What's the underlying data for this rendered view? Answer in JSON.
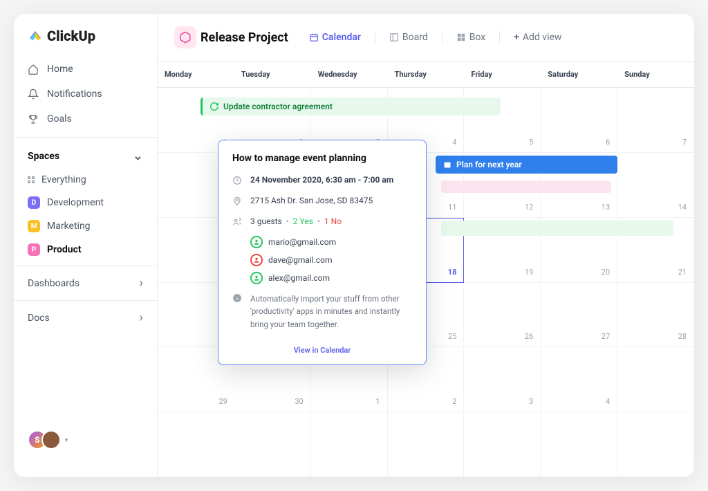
{
  "logo": "ClickUp",
  "nav": {
    "home": "Home",
    "notifications": "Notifications",
    "goals": "Goals"
  },
  "spaces": {
    "title": "Spaces",
    "everything": "Everything",
    "items": [
      {
        "letter": "D",
        "label": "Development",
        "color": "#7c6ff5"
      },
      {
        "letter": "M",
        "label": "Marketing",
        "color": "#fbbf24"
      },
      {
        "letter": "P",
        "label": "Product",
        "color": "#f472b6"
      }
    ]
  },
  "collapse": {
    "dashboards": "Dashboards",
    "docs": "Docs"
  },
  "project": {
    "title": "Release Project"
  },
  "views": {
    "calendar": "Calendar",
    "board": "Board",
    "box": "Box",
    "add": "Add view"
  },
  "weekdays": [
    "Monday",
    "Tuesday",
    "Wednesday",
    "Thursday",
    "Friday",
    "Saturday",
    "Sunday"
  ],
  "daynums": [
    "1",
    "2",
    "3",
    "4",
    "5",
    "6",
    "7",
    "",
    "",
    "",
    "11",
    "12",
    "13",
    "14",
    "",
    "",
    "",
    "18",
    "19",
    "20",
    "21",
    "",
    "",
    "",
    "25",
    "26",
    "27",
    "28",
    "29",
    "30",
    "1",
    "2",
    "3",
    "4"
  ],
  "events": {
    "contractor": "Update contractor agreement",
    "manage": "How to manage event planning",
    "plan": "Plan for next year"
  },
  "popover": {
    "title": "How to manage event planning",
    "datetime": "24 November 2020, 6:30 am - 7:00 am",
    "location": "2715 Ash Dr. San Jose, SD 83475",
    "guests_count": "3 guests",
    "yes": "2 Yes",
    "no": "1 No",
    "guests": [
      {
        "email": "mario@gmail.com",
        "color": "#22c55e"
      },
      {
        "email": "dave@gmail.com",
        "color": "#ef4444"
      },
      {
        "email": "alex@gmail.com",
        "color": "#22c55e"
      }
    ],
    "desc": "Automatically import your stuff from other 'productivity' apps in minutes and instantly bring your team together.",
    "footer": "View in Calendar"
  },
  "avatar_letter": "S"
}
